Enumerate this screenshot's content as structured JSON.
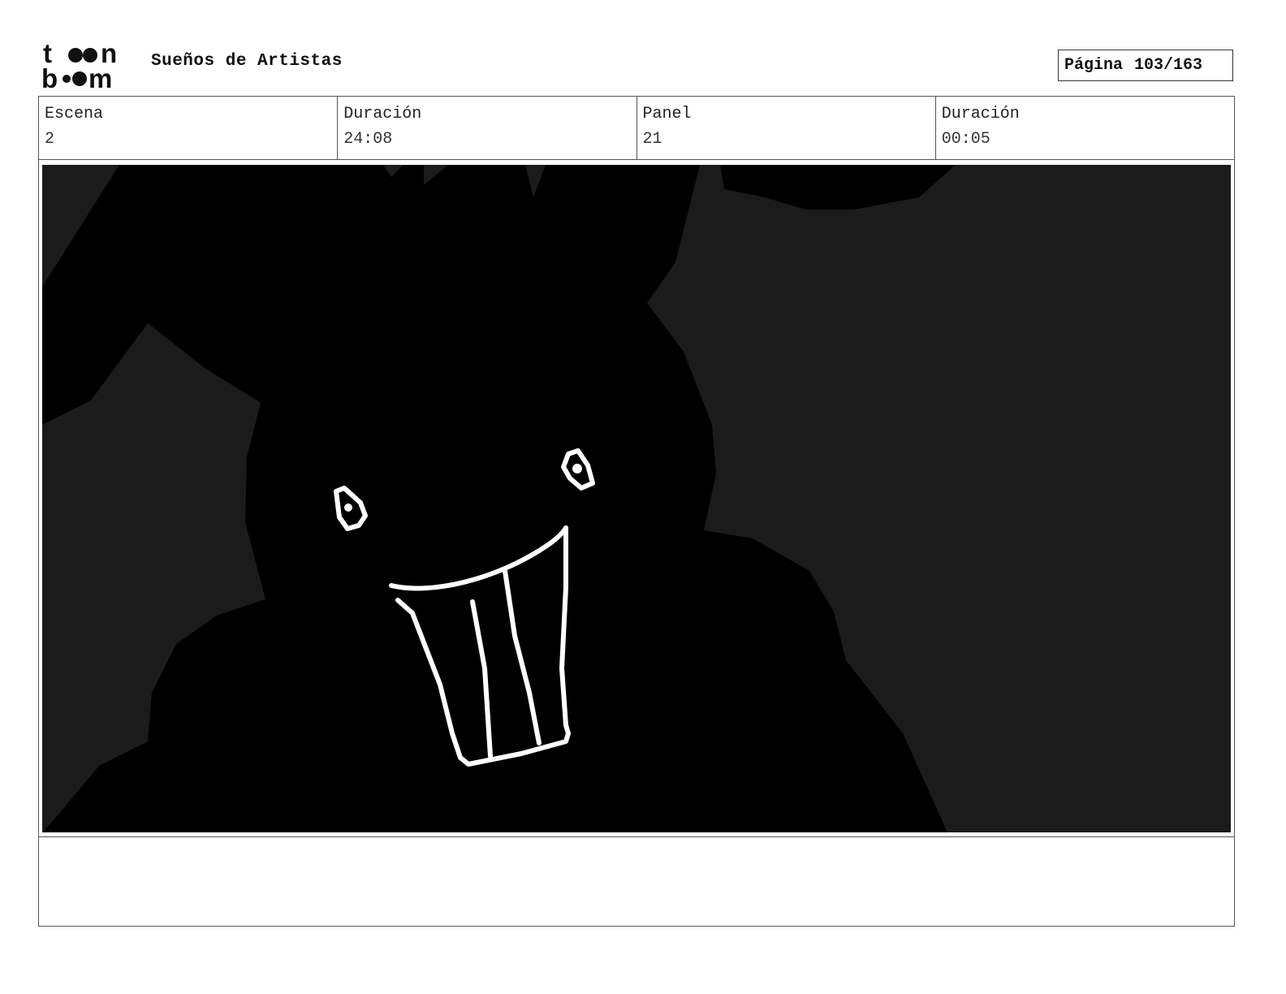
{
  "header": {
    "logo_top": "t",
    "logo_top_end": "n",
    "logo_bottom_start": "b",
    "logo_bottom_end": "m",
    "project_title": "Sueños de Artistas",
    "page_label": "Página",
    "page_value": "103/163"
  },
  "info": {
    "scene_label": "Escena",
    "scene_value": "2",
    "scene_duration_label": "Duración",
    "scene_duration_value": "24:08",
    "panel_label": "Panel",
    "panel_value": "21",
    "panel_duration_label": "Duración",
    "panel_duration_value": "00:05"
  },
  "notes": {
    "text": ""
  },
  "colors": {
    "panel_background": "#1b1b1b",
    "silhouette": "#000000",
    "line_art": "#ffffff"
  }
}
